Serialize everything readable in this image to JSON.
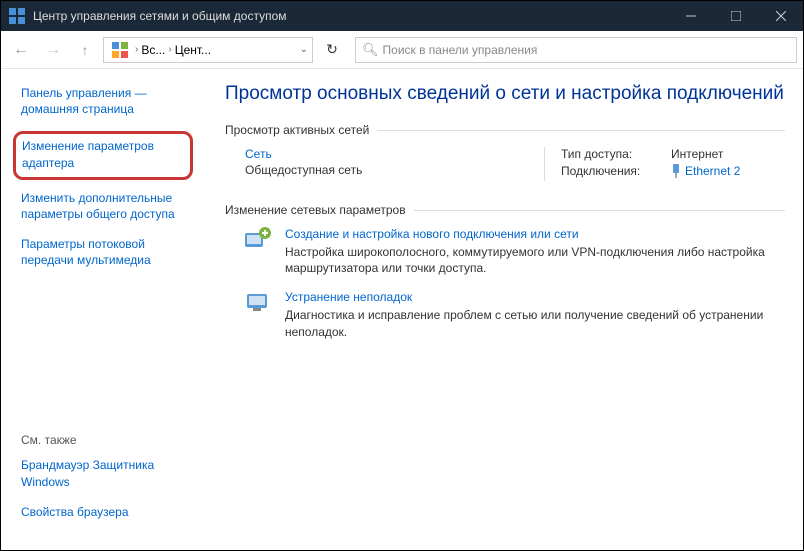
{
  "title": "Центр управления сетями и общим доступом",
  "breadcrumbs": {
    "item1": "Вс...",
    "item2": "Цент..."
  },
  "search": {
    "placeholder": "Поиск в панели управления"
  },
  "sidebar": {
    "home": "Панель управления — домашняя страница",
    "adapter": "Изменение параметров адаптера",
    "sharing": "Изменить дополнительные параметры общего доступа",
    "media": "Параметры потоковой передачи мультимедиа",
    "see_also": "См. также",
    "firewall": "Брандмауэр Защитника Windows",
    "browser": "Свойства браузера"
  },
  "main": {
    "heading": "Просмотр основных сведений о сети и настройка подключений",
    "active_nets": "Просмотр активных сетей",
    "net_name": "Сеть",
    "net_type": "Общедоступная сеть",
    "access_label": "Тип доступа:",
    "access_value": "Интернет",
    "conn_label": "Подключения:",
    "conn_value": "Ethernet 2",
    "change_params": "Изменение сетевых параметров",
    "new_conn_title": "Создание и настройка нового подключения или сети",
    "new_conn_desc": "Настройка широкополосного, коммутируемого или VPN-подключения либо настройка маршрутизатора или точки доступа.",
    "troubleshoot_title": "Устранение неполадок",
    "troubleshoot_desc": "Диагностика и исправление проблем с сетью или получение сведений об устранении неполадок."
  }
}
